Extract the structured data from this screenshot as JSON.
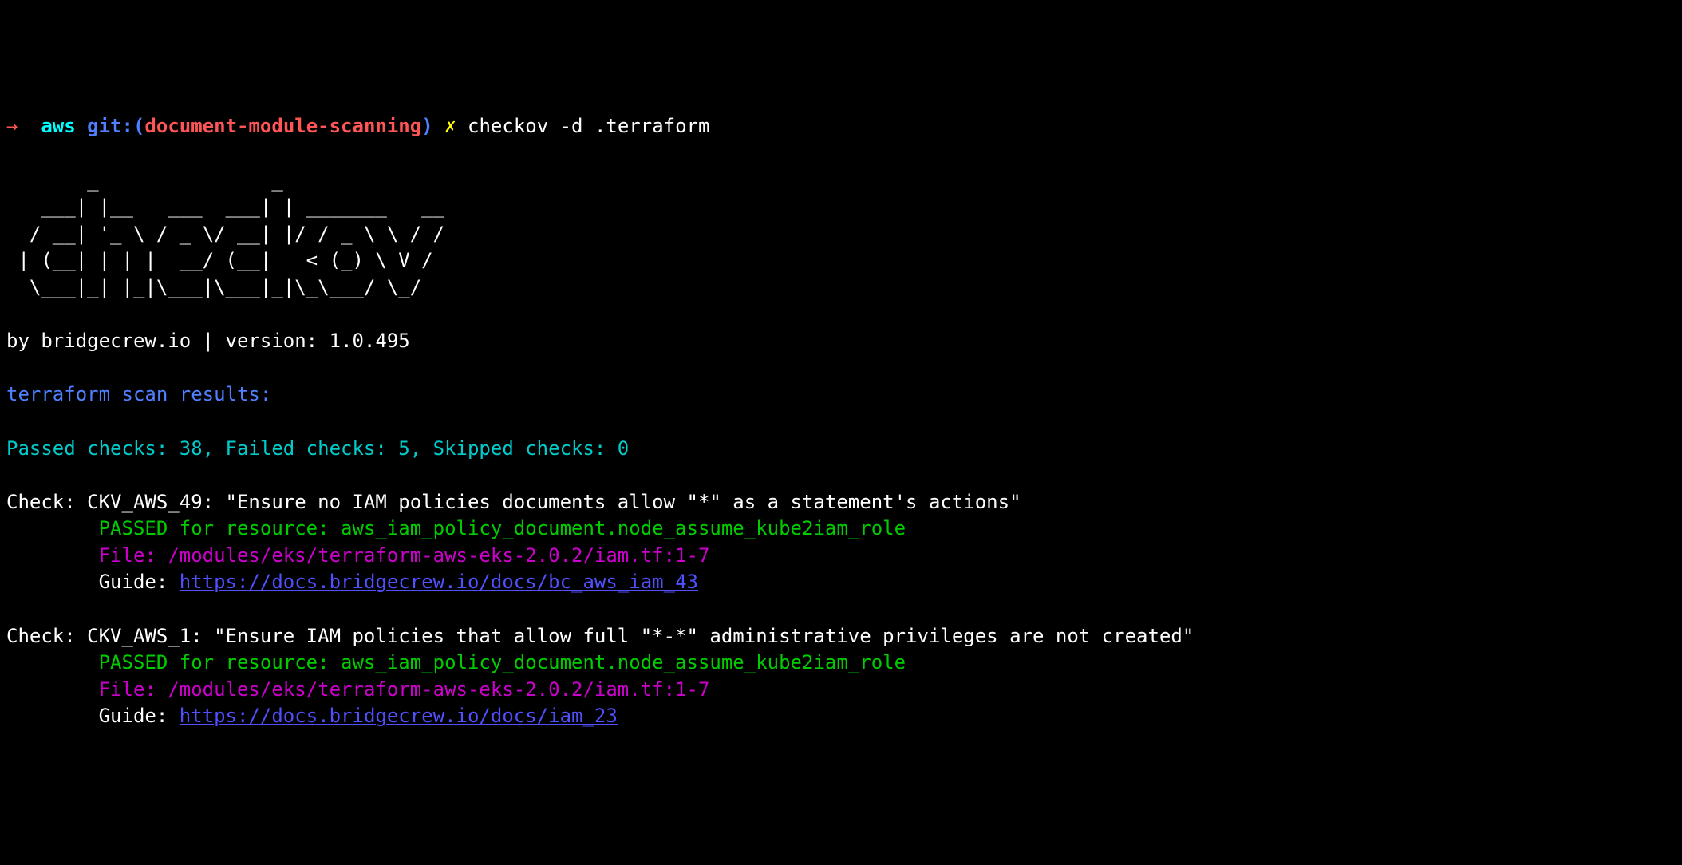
{
  "prompt": {
    "arrow": "→",
    "context": "aws",
    "git_label": "git:(",
    "branch": "document-module-scanning",
    "git_close": ")",
    "x": "✗",
    "command": "checkov -d .terraform"
  },
  "ascii_art": "       _               _              \n   ___| |__   ___  ___| | _______   __\n  / __| '_ \\ / _ \\/ __| |/ / _ \\ \\ / /\n | (__| | | |  __/ (__|   < (_) \\ V / \n  \\___|_| |_|\\___|\\___|_|\\_\\___/ \\_/  \n                                      ",
  "byline": "by bridgecrew.io | version: 1.0.495",
  "scan_header": "terraform scan results:",
  "summary": "Passed checks: 38, Failed checks: 5, Skipped checks: 0",
  "checks": [
    {
      "title": "Check: CKV_AWS_49: \"Ensure no IAM policies documents allow \"*\" as a statement's actions\"",
      "result": "PASSED for resource: aws_iam_policy_document.node_assume_kube2iam_role",
      "file": "File: /modules/eks/terraform-aws-eks-2.0.2/iam.tf:1-7",
      "guide_label": "Guide: ",
      "guide_url": "https://docs.bridgecrew.io/docs/bc_aws_iam_43"
    },
    {
      "title": "Check: CKV_AWS_1: \"Ensure IAM policies that allow full \"*-*\" administrative privileges are not created\"",
      "result": "PASSED for resource: aws_iam_policy_document.node_assume_kube2iam_role",
      "file": "File: /modules/eks/terraform-aws-eks-2.0.2/iam.tf:1-7",
      "guide_label": "Guide: ",
      "guide_url": "https://docs.bridgecrew.io/docs/iam_23"
    }
  ]
}
